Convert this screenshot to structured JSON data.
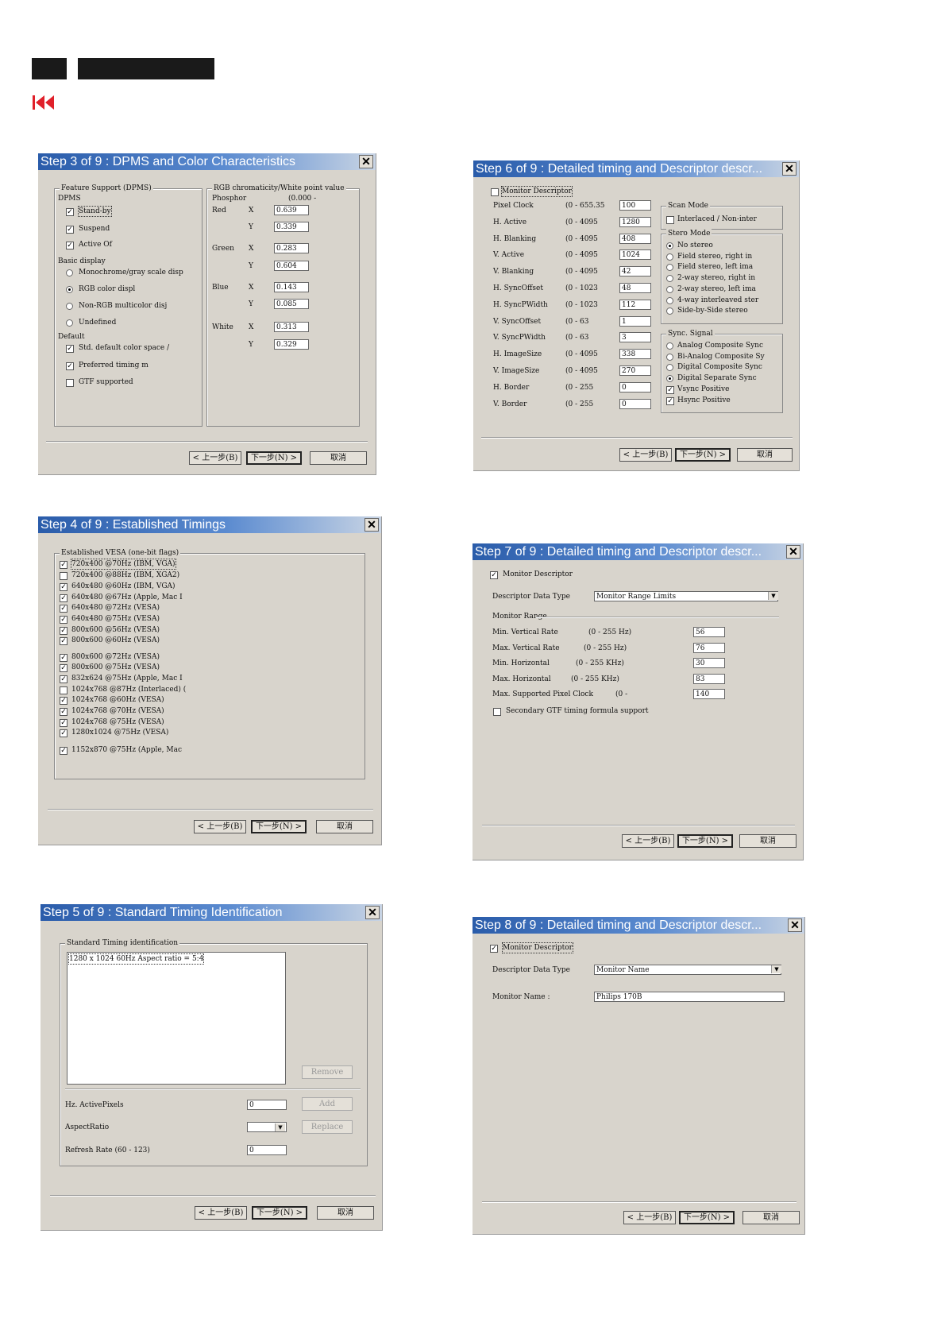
{
  "dialog3": {
    "title": "Step 3 of 9 : DPMS and Color Characteristics",
    "feature_group": "Feature Support (DPMS)",
    "dpms_label": "DPMS",
    "dpms": [
      {
        "label": "Stand-by",
        "checked": true
      },
      {
        "label": "Suspend",
        "checked": true
      },
      {
        "label": "Active Of",
        "checked": true
      }
    ],
    "basic_label": "Basic display",
    "basic": [
      {
        "label": "Monochrome/gray scale disp",
        "selected": false
      },
      {
        "label": "RGB color displ",
        "selected": true
      },
      {
        "label": "Non-RGB multicolor disj",
        "selected": false
      },
      {
        "label": "Undefined",
        "selected": false
      }
    ],
    "default_label": "Default",
    "defaults": [
      {
        "label": "Std. default color space /",
        "checked": true
      },
      {
        "label": "Preferred timing m",
        "checked": true
      },
      {
        "label": "GTF supported",
        "checked": false
      }
    ],
    "rgb_group": "RGB chromaticity/White point value",
    "phosphor_label": "Phosphor",
    "range_label": "(0.000 -",
    "red": "Red",
    "green": "Green",
    "blue": "Blue",
    "white": "White",
    "x": "X",
    "y": "Y",
    "values": [
      "0.639",
      "0.339",
      "0.283",
      "0.604",
      "0.143",
      "0.085",
      "0.313",
      "0.329"
    ]
  },
  "dialog4": {
    "title": "Step 4 of 9 : Established Timings",
    "group": "Established VESA (one-bit flags)",
    "timings": [
      {
        "label": "720x400 @70Hz (IBM, VGA)",
        "checked": true
      },
      {
        "label": "720x400 @88Hz (IBM, XGA2)",
        "checked": false
      },
      {
        "label": "640x480 @60Hz (IBM, VGA)",
        "checked": true
      },
      {
        "label": "640x480 @67Hz (Apple, Mac I",
        "checked": true
      },
      {
        "label": "640x480 @72Hz (VESA)",
        "checked": true
      },
      {
        "label": "640x480 @75Hz (VESA)",
        "checked": true
      },
      {
        "label": "800x600 @56Hz (VESA)",
        "checked": true
      },
      {
        "label": "800x600 @60Hz (VESA)",
        "checked": true
      },
      {
        "label": "800x600 @72Hz (VESA)",
        "checked": true
      },
      {
        "label": "800x600 @75Hz (VESA)",
        "checked": true
      },
      {
        "label": "832x624 @75Hz (Apple, Mac I",
        "checked": true
      },
      {
        "label": "1024x768 @87Hz (Interlaced) (",
        "checked": false
      },
      {
        "label": "1024x768 @60Hz (VESA)",
        "checked": true
      },
      {
        "label": "1024x768 @70Hz (VESA)",
        "checked": true
      },
      {
        "label": "1024x768 @75Hz (VESA)",
        "checked": true
      },
      {
        "label": "1280x1024 @75Hz (VESA)",
        "checked": true
      },
      {
        "label": "1152x870 @75Hz (Apple, Mac",
        "checked": true
      }
    ]
  },
  "dialog5": {
    "title": "Step 5 of 9 : Standard Timing Identification",
    "group": "Standard Timing identification",
    "list_item": "1280 x 1024      60Hz    Aspect ratio =  5:4",
    "remove": "Remove",
    "add": "Add",
    "replace": "Replace",
    "hz_active": "Hz. ActivePixels",
    "hz_active_value": "0",
    "aspect": "AspectRatio",
    "refresh": "Refresh Rate (60 - 123)",
    "refresh_value": "0"
  },
  "dialog6": {
    "title": "Step 6 of 9 : Detailed timing and Descriptor descr...",
    "monitor_descriptor": "Monitor Descriptor",
    "md_checked": false,
    "rows": [
      {
        "label": "Pixel Clock",
        "range": "(0 - 655.35",
        "value": "100"
      },
      {
        "label": "H. Active",
        "range": "(0 - 4095",
        "value": "1280"
      },
      {
        "label": "H. Blanking",
        "range": "(0 - 4095",
        "value": "408"
      },
      {
        "label": "V. Active",
        "range": "(0 - 4095",
        "value": "1024"
      },
      {
        "label": "V. Blanking",
        "range": "(0 - 4095",
        "value": "42"
      },
      {
        "label": "H. SyncOffset",
        "range": "(0 - 1023",
        "value": "48"
      },
      {
        "label": "H. SyncPWidth",
        "range": "(0 - 1023",
        "value": "112"
      },
      {
        "label": "V. SyncOffset",
        "range": "(0 - 63",
        "value": "1"
      },
      {
        "label": "V. SyncPWidth",
        "range": "(0 - 63",
        "value": "3"
      },
      {
        "label": "H. ImageSize",
        "range": "(0 - 4095",
        "value": "338"
      },
      {
        "label": "V. ImageSize",
        "range": "(0 - 4095",
        "value": "270"
      },
      {
        "label": "H. Border",
        "range": "(0 - 255",
        "value": "0"
      },
      {
        "label": "V. Border",
        "range": "(0 - 255",
        "value": "0"
      }
    ],
    "scan_group": "Scan Mode",
    "scan_item": "Interlaced / Non-inter",
    "stereo_group": "Stero Mode",
    "stereo": [
      {
        "label": "No stereo",
        "selected": true
      },
      {
        "label": "Field stereo, right in",
        "selected": false
      },
      {
        "label": "Field stereo, left ima",
        "selected": false
      },
      {
        "label": "2-way stereo, right in",
        "selected": false
      },
      {
        "label": "2-way stereo, left ima",
        "selected": false
      },
      {
        "label": "4-way interleaved ster",
        "selected": false
      },
      {
        "label": "Side-by-Side stereo",
        "selected": false
      }
    ],
    "sync_group": "Sync. Signal",
    "sync": [
      {
        "label": "Analog Composite Sync",
        "selected": false
      },
      {
        "label": "Bi-Analog Composite Sy",
        "selected": false
      },
      {
        "label": "Digital Composite Sync",
        "selected": false
      },
      {
        "label": "Digital Separate Sync",
        "selected": true
      }
    ],
    "sync_checks": [
      {
        "label": "Vsync Positive",
        "checked": true
      },
      {
        "label": "Hsync Positive",
        "checked": true
      }
    ]
  },
  "dialog7": {
    "title": "Step 7 of 9 : Detailed timing and Descriptor descr...",
    "monitor_descriptor": "Monitor Descriptor",
    "ddt_label": "Descriptor Data Type",
    "ddt_value": "Monitor Range Limits",
    "range_group": "Monitor Range",
    "rows": [
      {
        "label": "Min. Vertical Rate",
        "range": "(0 - 255 Hz)",
        "value": "56"
      },
      {
        "label": "Max. Vertical Rate",
        "range": "(0 - 255 Hz)",
        "value": "76"
      },
      {
        "label": "Min. Horizontal",
        "range": "(0 - 255 KHz)",
        "value": "30"
      },
      {
        "label": "Max. Horizontal",
        "range": "(0 - 255 KHz)",
        "value": "83"
      },
      {
        "label": "Max. Supported Pixel Clock",
        "range": "(0 -",
        "value": "140"
      }
    ],
    "secondary": "Secondary GTF timing formula support"
  },
  "dialog8": {
    "title": "Step 8 of 9 : Detailed timing and Descriptor descr...",
    "monitor_descriptor": "Monitor Descriptor",
    "ddt_label": "Descriptor Data Type",
    "ddt_value": "Monitor Name",
    "name_label": "Monitor Name :",
    "name_value": "Philips 170B"
  },
  "buttons": {
    "back": "< 上一步(B)",
    "next": "下一步(N) >",
    "cancel": "取消"
  },
  "icons": {
    "nav": "skip-back-icon",
    "close": "close-icon"
  },
  "colors": {
    "titlebar_start": "#2a5caa",
    "titlebar_end": "#c8d4e4",
    "dialog_bg": "#d8d4cc",
    "nav_icon": "#e0202a"
  }
}
